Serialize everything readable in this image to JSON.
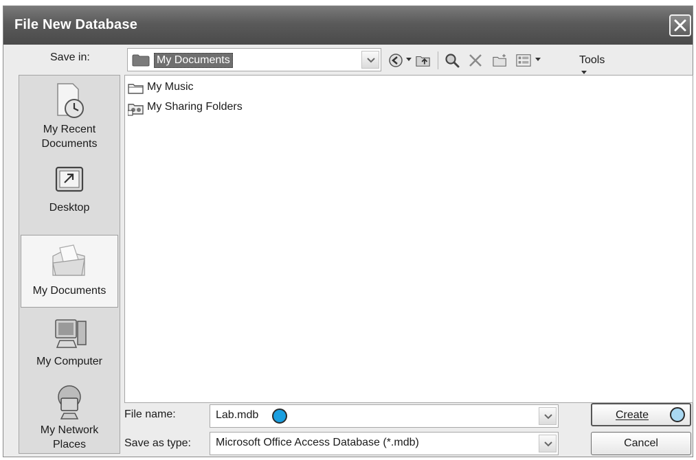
{
  "window": {
    "title": "File New Database"
  },
  "save_in": {
    "label": "Save in:",
    "value": "My Documents"
  },
  "toolbar": {
    "tools_label": "Tools",
    "icons": [
      "back-icon",
      "up-folder-icon",
      "search-web-icon",
      "delete-icon",
      "new-folder-icon",
      "views-icon"
    ]
  },
  "places": [
    {
      "label_line1": "My Recent",
      "label_line2": "Documents",
      "icon": "recent-documents-icon"
    },
    {
      "label_line1": "Desktop",
      "label_line2": "",
      "icon": "desktop-icon"
    },
    {
      "label_line1": "My Documents",
      "label_line2": "",
      "icon": "my-documents-icon",
      "selected": true
    },
    {
      "label_line1": "My Computer",
      "label_line2": "",
      "icon": "my-computer-icon"
    },
    {
      "label_line1": "My Network",
      "label_line2": "Places",
      "icon": "network-places-icon"
    }
  ],
  "files": [
    {
      "name": "My Music",
      "icon": "folder-icon"
    },
    {
      "name": "My Sharing Folders",
      "icon": "shared-folder-icon"
    }
  ],
  "file_name": {
    "label": "File name:",
    "value": "Lab.mdb"
  },
  "save_as_type": {
    "label": "Save as type:",
    "value": "Microsoft Office Access Database (*.mdb)"
  },
  "buttons": {
    "create": "Create",
    "cancel": "Cancel"
  },
  "colors": {
    "title_bar": "#5a5a5a",
    "marker_filled": "#1a9fe0",
    "marker_light": "#a9d8f2"
  }
}
